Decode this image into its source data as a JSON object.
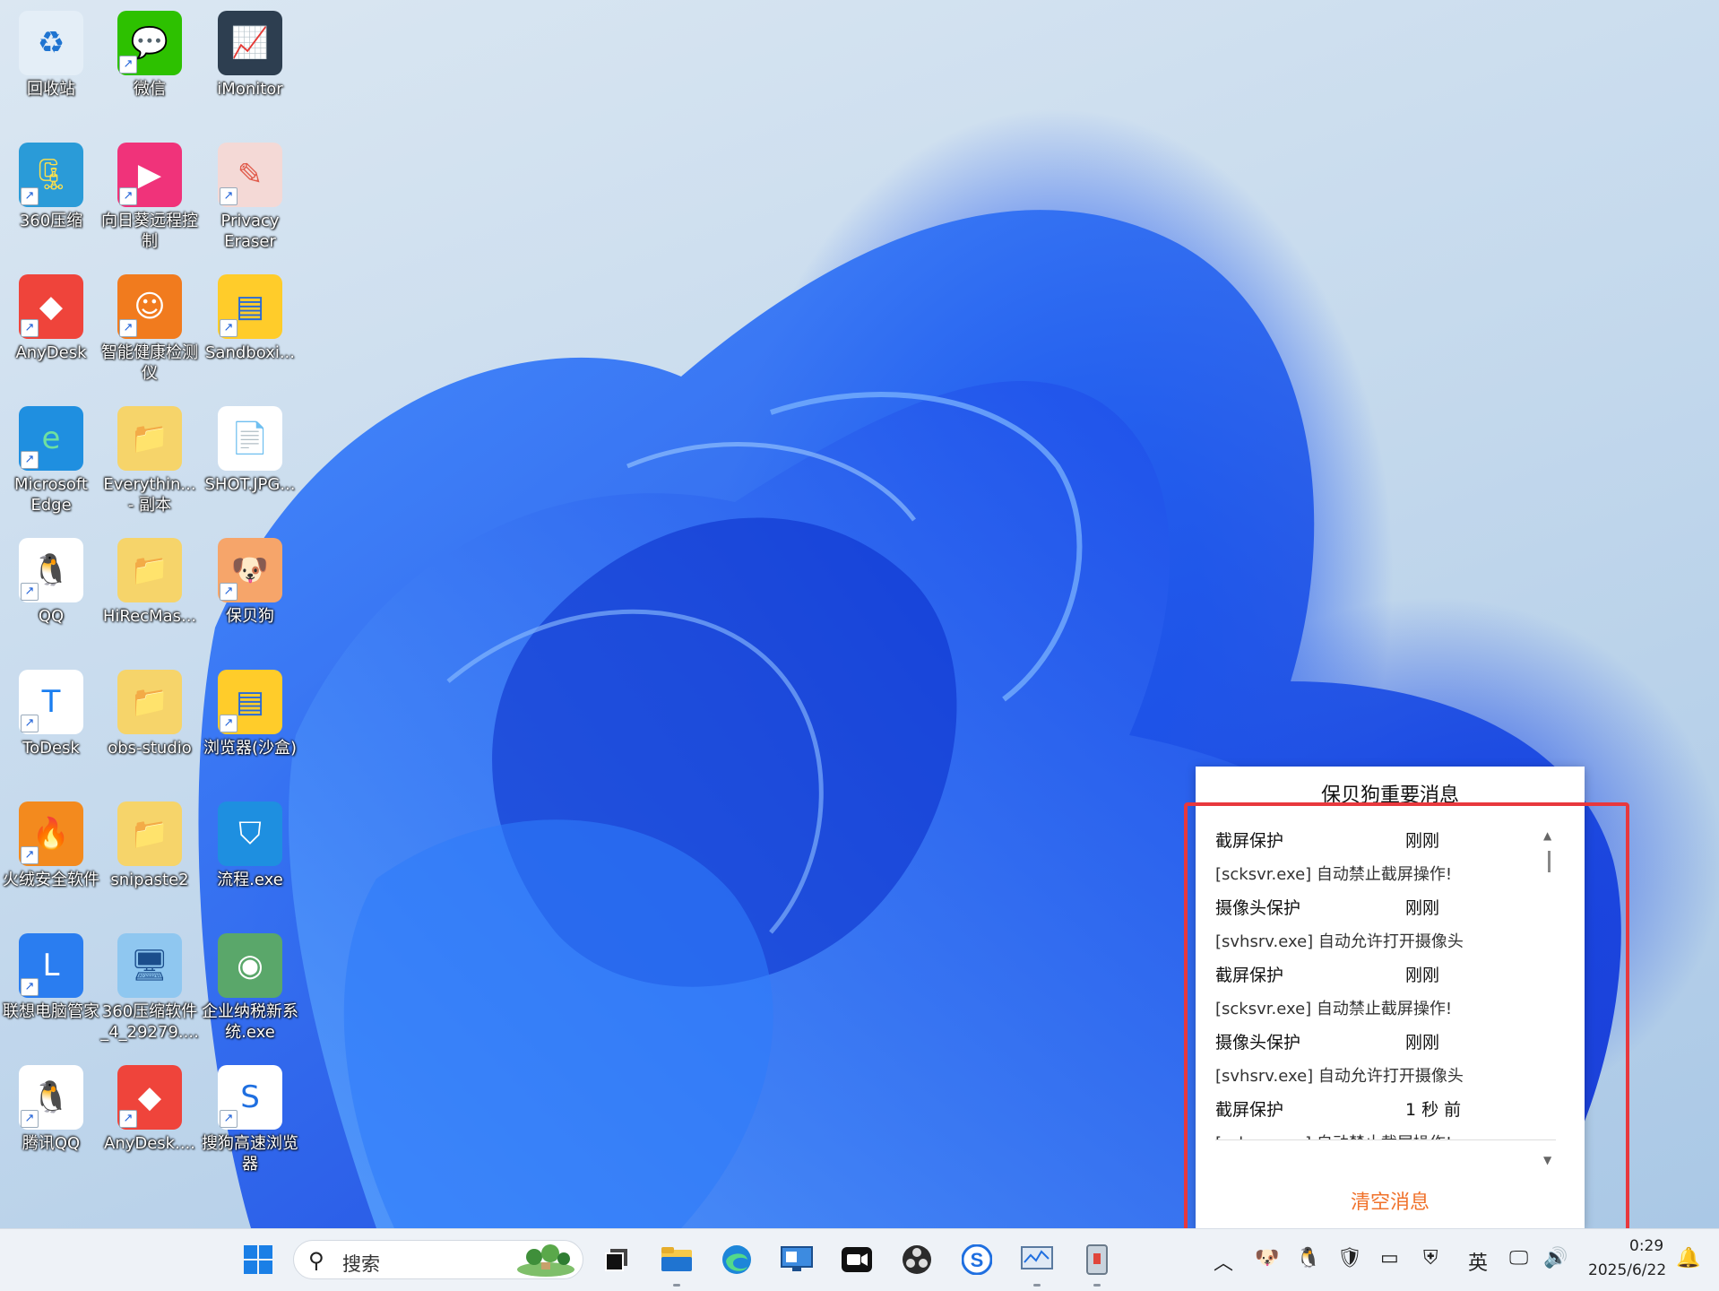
{
  "desktop": {
    "icons": [
      {
        "label": "回收站",
        "glyph": "♻",
        "bg": "#e4eef7",
        "fg": "#1f74d1",
        "shortcut": false
      },
      {
        "label": "微信",
        "glyph": "💬",
        "bg": "#2dc100",
        "fg": "#ffffff",
        "shortcut": true
      },
      {
        "label": "iMonitor",
        "glyph": "📈",
        "bg": "#2d3e50",
        "fg": "#5ad1ff",
        "shortcut": false
      },
      {
        "label": "360压缩",
        "glyph": "🗜",
        "bg": "#2a9bd8",
        "fg": "#ffe04a",
        "shortcut": true
      },
      {
        "label": "向日葵远程控制",
        "glyph": "▶",
        "bg": "#f0337a",
        "fg": "#ffffff",
        "shortcut": true
      },
      {
        "label": "Privacy Eraser",
        "glyph": "✎",
        "bg": "#f4d9d6",
        "fg": "#e05a4a",
        "shortcut": true
      },
      {
        "label": "AnyDesk",
        "glyph": "◆",
        "bg": "#ef443b",
        "fg": "#ffffff",
        "shortcut": true
      },
      {
        "label": "智能健康检测仪",
        "glyph": "☺",
        "bg": "#f17b1e",
        "fg": "#ffffff",
        "shortcut": true
      },
      {
        "label": "Sandboxi...",
        "glyph": "▤",
        "bg": "#ffcc2a",
        "fg": "#2a6bd6",
        "shortcut": true
      },
      {
        "label": "Microsoft Edge",
        "glyph": "e",
        "bg": "#1f8fe0",
        "fg": "#6ee0a0",
        "shortcut": true
      },
      {
        "label": "Everythin... - 副本",
        "glyph": "📁",
        "bg": "#f6d46a",
        "fg": "#ffffff",
        "shortcut": false
      },
      {
        "label": "SHOT.JPG...",
        "glyph": "📄",
        "bg": "#ffffff",
        "fg": "#bbbbbb",
        "shortcut": false
      },
      {
        "label": "QQ",
        "glyph": "🐧",
        "bg": "#ffffff",
        "fg": "#111111",
        "shortcut": true
      },
      {
        "label": "HiRecMas...",
        "glyph": "📁",
        "bg": "#f6d46a",
        "fg": "#ffffff",
        "shortcut": false
      },
      {
        "label": "保贝狗",
        "glyph": "🐶",
        "bg": "#f6a56a",
        "fg": "#ffffff",
        "shortcut": true
      },
      {
        "label": "ToDesk",
        "glyph": "T",
        "bg": "#ffffff",
        "fg": "#1a7ef0",
        "shortcut": true
      },
      {
        "label": "obs-studio",
        "glyph": "📁",
        "bg": "#f6d46a",
        "fg": "#ffffff",
        "shortcut": false
      },
      {
        "label": "浏览器(沙盒)",
        "glyph": "▤",
        "bg": "#ffcc2a",
        "fg": "#2a6bd6",
        "shortcut": true
      },
      {
        "label": "火绒安全软件",
        "glyph": "🔥",
        "bg": "#f38a1e",
        "fg": "#ffffff",
        "shortcut": true
      },
      {
        "label": "snipaste2",
        "glyph": "📁",
        "bg": "#f6d46a",
        "fg": "#ffffff",
        "shortcut": false
      },
      {
        "label": "流程.exe",
        "glyph": "⛉",
        "bg": "#1e8fe0",
        "fg": "#ffffff",
        "shortcut": false
      },
      {
        "label": "联想电脑管家",
        "glyph": "L",
        "bg": "#2a7df0",
        "fg": "#ffffff",
        "shortcut": true
      },
      {
        "label": "360压缩软件_4_29279....",
        "glyph": "🖥",
        "bg": "#8fc7f0",
        "fg": "#1b4e8c",
        "shortcut": false
      },
      {
        "label": "企业纳税新系统.exe",
        "glyph": "◉",
        "bg": "#5aa76a",
        "fg": "#ffffff",
        "shortcut": false
      },
      {
        "label": "腾讯QQ",
        "glyph": "🐧",
        "bg": "#ffffff",
        "fg": "#111111",
        "shortcut": true
      },
      {
        "label": "AnyDesk....",
        "glyph": "◆",
        "bg": "#ef443b",
        "fg": "#ffffff",
        "shortcut": true
      },
      {
        "label": "搜狗高速浏览器",
        "glyph": "S",
        "bg": "#ffffff",
        "fg": "#1f6fe0",
        "shortcut": true
      }
    ]
  },
  "popup": {
    "title": "保贝狗重要消息",
    "messages": [
      {
        "category": "截屏保护",
        "time": "刚刚",
        "body": "[scksvr.exe] 自动禁止截屏操作!"
      },
      {
        "category": "摄像头保护",
        "time": "刚刚",
        "body": "[svhsrv.exe] 自动允许打开摄像头"
      },
      {
        "category": "截屏保护",
        "time": "刚刚",
        "body": "[scksvr.exe] 自动禁止截屏操作!"
      },
      {
        "category": "摄像头保护",
        "time": "刚刚",
        "body": "[svhsrv.exe] 自动允许打开摄像头"
      },
      {
        "category": "截屏保护",
        "time": "1 秒 前",
        "body": "[scksvr.exe] 自动禁止截屏操作!"
      }
    ],
    "clear_label": "清空消息",
    "highlight_color": "#e8383d"
  },
  "taskbar": {
    "search_placeholder": "搜索",
    "tray_language": "英",
    "clock_time": "0:29",
    "clock_date": "2025/6/22"
  }
}
